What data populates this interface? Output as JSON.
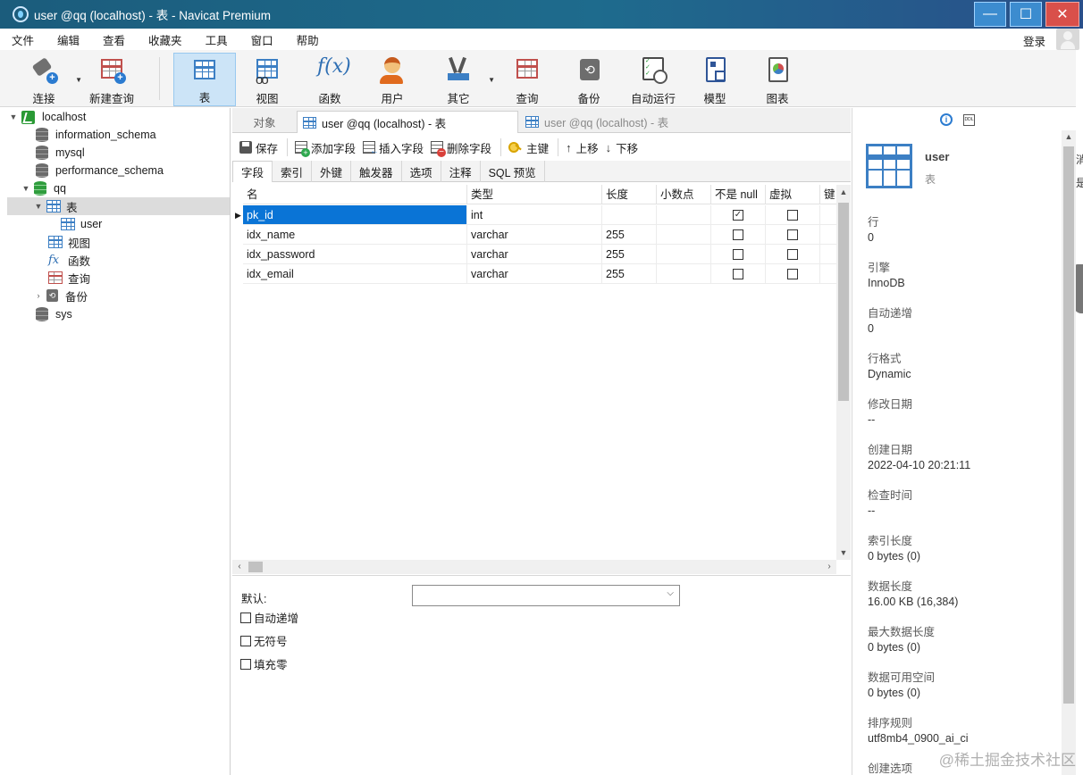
{
  "window": {
    "title": "user @qq (localhost) - 表 - Navicat Premium",
    "minimize_glyph": "—",
    "maximize_glyph": "☐",
    "close_glyph": "✕"
  },
  "menu": [
    "文件",
    "编辑",
    "查看",
    "收藏夹",
    "工具",
    "窗口",
    "帮助"
  ],
  "account": {
    "login_label": "登录"
  },
  "toolbar": {
    "connect": "连接",
    "new_query": "新建查询",
    "table": "表",
    "view": "视图",
    "function": "函数",
    "user": "用户",
    "other": "其它",
    "query": "查询",
    "backup": "备份",
    "automation": "自动运行",
    "model": "模型",
    "chart": "图表"
  },
  "tree": {
    "connection": "localhost",
    "databases": [
      "information_schema",
      "mysql",
      "performance_schema",
      "qq",
      "sys"
    ],
    "qq_children": {
      "tables": "表",
      "views": "视图",
      "functions": "函数",
      "queries": "查询",
      "backups": "备份"
    },
    "table_item": "user"
  },
  "doc_tabs": {
    "objects": "对象",
    "active": "user @qq (localhost) - 表",
    "inactive": "user @qq (localhost) - 表"
  },
  "field_toolbar": {
    "save": "保存",
    "add_field": "添加字段",
    "insert_field": "插入字段",
    "delete_field": "删除字段",
    "primary_key": "主键",
    "move_up": "上移",
    "move_down": "下移"
  },
  "prop_tabs": [
    "字段",
    "索引",
    "外键",
    "触发器",
    "选项",
    "注释",
    "SQL 预览"
  ],
  "grid": {
    "columns": [
      "名",
      "类型",
      "长度",
      "小数点",
      "不是 null",
      "虚拟",
      "键"
    ],
    "rows": [
      {
        "name": "pk_id",
        "type": "int",
        "length": "",
        "decimals": "",
        "not_null": true,
        "virtual": false,
        "key": true
      },
      {
        "name": "idx_name",
        "type": "varchar",
        "length": "255",
        "decimals": "",
        "not_null": false,
        "virtual": false,
        "key": false
      },
      {
        "name": "idx_password",
        "type": "varchar",
        "length": "255",
        "decimals": "",
        "not_null": false,
        "virtual": false,
        "key": false
      },
      {
        "name": "idx_email",
        "type": "varchar",
        "length": "255",
        "decimals": "",
        "not_null": false,
        "virtual": false,
        "key": false
      }
    ]
  },
  "field_props": {
    "default_label": "默认:",
    "default_value": "",
    "auto_increment": "自动递增",
    "unsigned": "无符号",
    "zerofill": "填充零"
  },
  "info": {
    "info_icon_glyph": "i",
    "ddl_icon_text": "DDL",
    "name": "user",
    "type": "表",
    "props": [
      {
        "k": "行",
        "v": "0"
      },
      {
        "k": "引擎",
        "v": "InnoDB"
      },
      {
        "k": "自动递增",
        "v": "0"
      },
      {
        "k": "行格式",
        "v": "Dynamic"
      },
      {
        "k": "修改日期",
        "v": "--"
      },
      {
        "k": "创建日期",
        "v": "2022-04-10 20:21:11"
      },
      {
        "k": "检查时间",
        "v": "--"
      },
      {
        "k": "索引长度",
        "v": "0 bytes (0)"
      },
      {
        "k": "数据长度",
        "v": "16.00 KB (16,384)"
      },
      {
        "k": "最大数据长度",
        "v": "0 bytes (0)"
      },
      {
        "k": "数据可用空间",
        "v": "0 bytes (0)"
      },
      {
        "k": "排序规则",
        "v": "utf8mb4_0900_ai_ci"
      },
      {
        "k": "创建选项",
        "v": ""
      }
    ]
  },
  "edge": {
    "t1": "消",
    "t2": "是"
  },
  "watermark": "@稀土掘金技术社区"
}
